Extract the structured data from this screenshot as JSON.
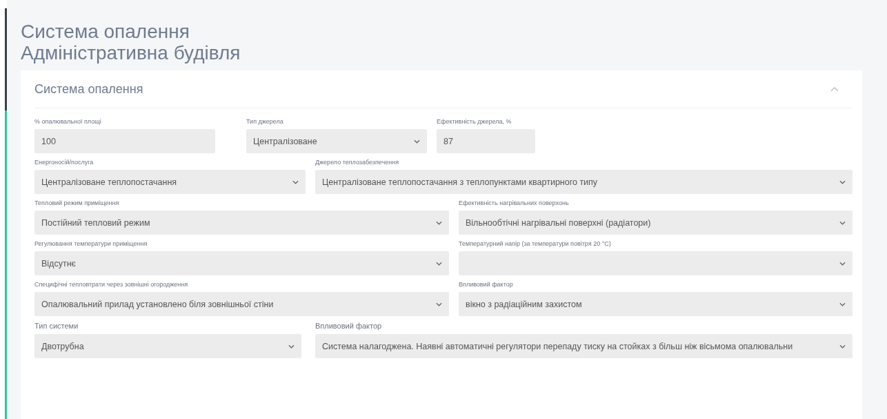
{
  "page_title": [
    "Система опалення",
    "Адміністративна будівля"
  ],
  "section": {
    "title": "Система опалення",
    "expanded": true,
    "rows": [
      {
        "fields": [
          {
            "label": "% опалювальної площі",
            "kind": "input",
            "value": "100"
          },
          {
            "label": "Тип джерела",
            "kind": "select",
            "value": "Централізоване"
          },
          {
            "label": "Ефективність джерела, %",
            "kind": "input",
            "value": "87"
          }
        ]
      },
      {
        "fields": [
          {
            "label": "Енергоносій/послуга",
            "kind": "select",
            "value": "Централізоване теплопостачання"
          },
          {
            "label": "Джерело теплозабезпечення",
            "kind": "select",
            "value": "Централізоване теплопостачання з теплопунктами квартирного типу"
          }
        ]
      },
      {
        "fields": [
          {
            "label": "Тепловий режим приміщення",
            "kind": "select",
            "value": "Постійний тепловий режим"
          },
          {
            "label": "Ефективність нагрівальних поверхонь",
            "kind": "select",
            "value": "Вільнообтічні нагрівальні поверхні (радіатори)"
          }
        ]
      },
      {
        "fields": [
          {
            "label": "Регулювання температури приміщення",
            "kind": "select",
            "value": "Відсутнє"
          },
          {
            "label": "Температурний напір (за температури повітря 20 °С)",
            "kind": "select"
          }
        ]
      },
      {
        "fields": [
          {
            "label": "Специфічні тепловтрати через зовнішні огородження",
            "kind": "select",
            "value": "Опалювальний прилад установлено біля зовнішньої стіни"
          },
          {
            "label": "Впливовий фактор",
            "kind": "select",
            "value": "вікно з радіаційним захистом"
          }
        ]
      },
      {
        "fields": [
          {
            "label": "Тип системи",
            "kind": "select",
            "value": "Двотрубна"
          },
          {
            "label": "Впливовий фактор",
            "kind": "select",
            "value": "Система налагоджена. Наявні автоматичні регулятори перепаду тиску на стойках з більш ніж вісьмома опалювальни"
          }
        ]
      }
    ]
  }
}
